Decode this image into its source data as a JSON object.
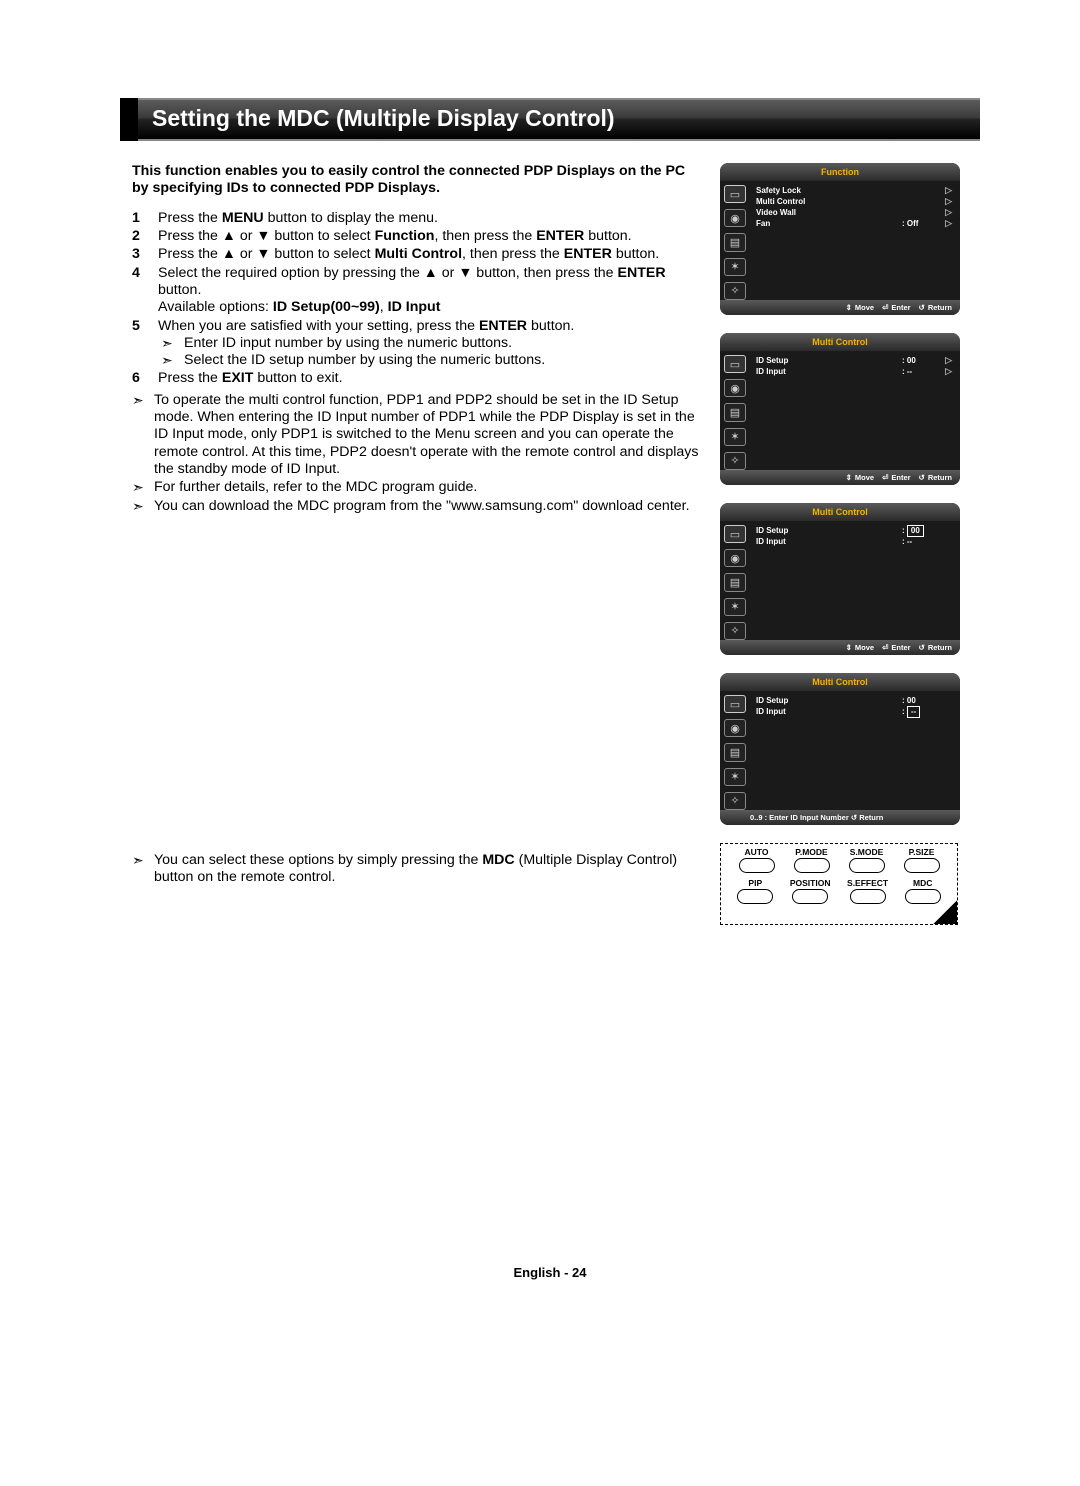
{
  "title": "Setting the MDC (Multiple Display Control)",
  "intro": "This function enables you to easily control the connected PDP Displays on the PC by specifying IDs to connected PDP Displays.",
  "steps": {
    "s1a": "Press the ",
    "s1b": "MENU",
    "s1c": " button to display the menu.",
    "s2a": "Press the ▲ or ▼ button to select ",
    "s2b": "Function",
    "s2c": ", then press the ",
    "s2d": "ENTER",
    "s2e": " button.",
    "s3a": "Press the ▲ or ▼ button to select ",
    "s3b": "Multi Control",
    "s3c": ", then press the ",
    "s3d": "ENTER",
    "s3e": " button.",
    "s4a": "Select the required option by pressing the ▲ or ▼ button, then press the ",
    "s4b": "ENTER",
    "s4c": " button.",
    "s4d": "Available options: ",
    "s4e": "ID Setup(00~99)",
    "s4f": ", ",
    "s4g": "ID Input",
    "s5a": "When you are satisfied with your setting, press the ",
    "s5b": "ENTER",
    "s5c": " button.",
    "s5n1": "Enter ID input number by using the numeric buttons.",
    "s5n2": "Select the ID setup number by using the numeric buttons.",
    "s6a": "Press the ",
    "s6b": "EXIT",
    "s6c": " button to exit."
  },
  "notes": {
    "n1": "To operate the multi control function, PDP1 and PDP2 should be set in the ID Setup mode. When entering the ID Input number of PDP1 while the PDP Display is set in the ID Input mode, only PDP1 is switched to the Menu screen and you can operate the remote control. At this time, PDP2 doesn't operate with the remote control and displays the standby mode of ID Input.",
    "n2": "For further details, refer to the MDC program guide.",
    "n3a": "You can download the MDC program from the \"www.samsung.com\" download center.",
    "n4a": "You can select these options by simply pressing the ",
    "n4b": "MDC",
    "n4c": " (Multiple Display Control) button on the remote control."
  },
  "osd": {
    "footer_move": "Move",
    "footer_enter": "Enter",
    "footer_return": "Return",
    "panel1": {
      "title": "Function",
      "rows": [
        {
          "lbl": "Safety Lock",
          "val": "",
          "arr": "▷"
        },
        {
          "lbl": "Multi Control",
          "val": "",
          "arr": "▷"
        },
        {
          "lbl": "Video Wall",
          "val": "",
          "arr": "▷"
        },
        {
          "lbl": "Fan",
          "val": ": Off",
          "arr": "▷"
        }
      ]
    },
    "panel2": {
      "title": "Multi Control",
      "rows": [
        {
          "lbl": "ID Setup",
          "val": ": 00",
          "arr": "▷"
        },
        {
          "lbl": "ID Input",
          "val": ": --",
          "arr": "▷"
        }
      ]
    },
    "panel3": {
      "title": "Multi Control",
      "rows": [
        {
          "lbl": "ID Setup",
          "val_hl": "00",
          "arr": ""
        },
        {
          "lbl": "ID Input",
          "val": ": --",
          "arr": ""
        }
      ]
    },
    "panel4": {
      "title": "Multi Control",
      "rows": [
        {
          "lbl": "ID Setup",
          "val": ": 00",
          "arr": ""
        },
        {
          "lbl": "ID Input",
          "val_hl": "--",
          "arr": ""
        }
      ],
      "footer": "0..9 : Enter ID Input Number      ↺  Return"
    }
  },
  "remote": {
    "row1": [
      "AUTO",
      "P.MODE",
      "S.MODE",
      "P.SIZE"
    ],
    "row2": [
      "PIP",
      "POSITION",
      "S.EFFECT",
      "MDC"
    ]
  },
  "footer": "English - 24"
}
